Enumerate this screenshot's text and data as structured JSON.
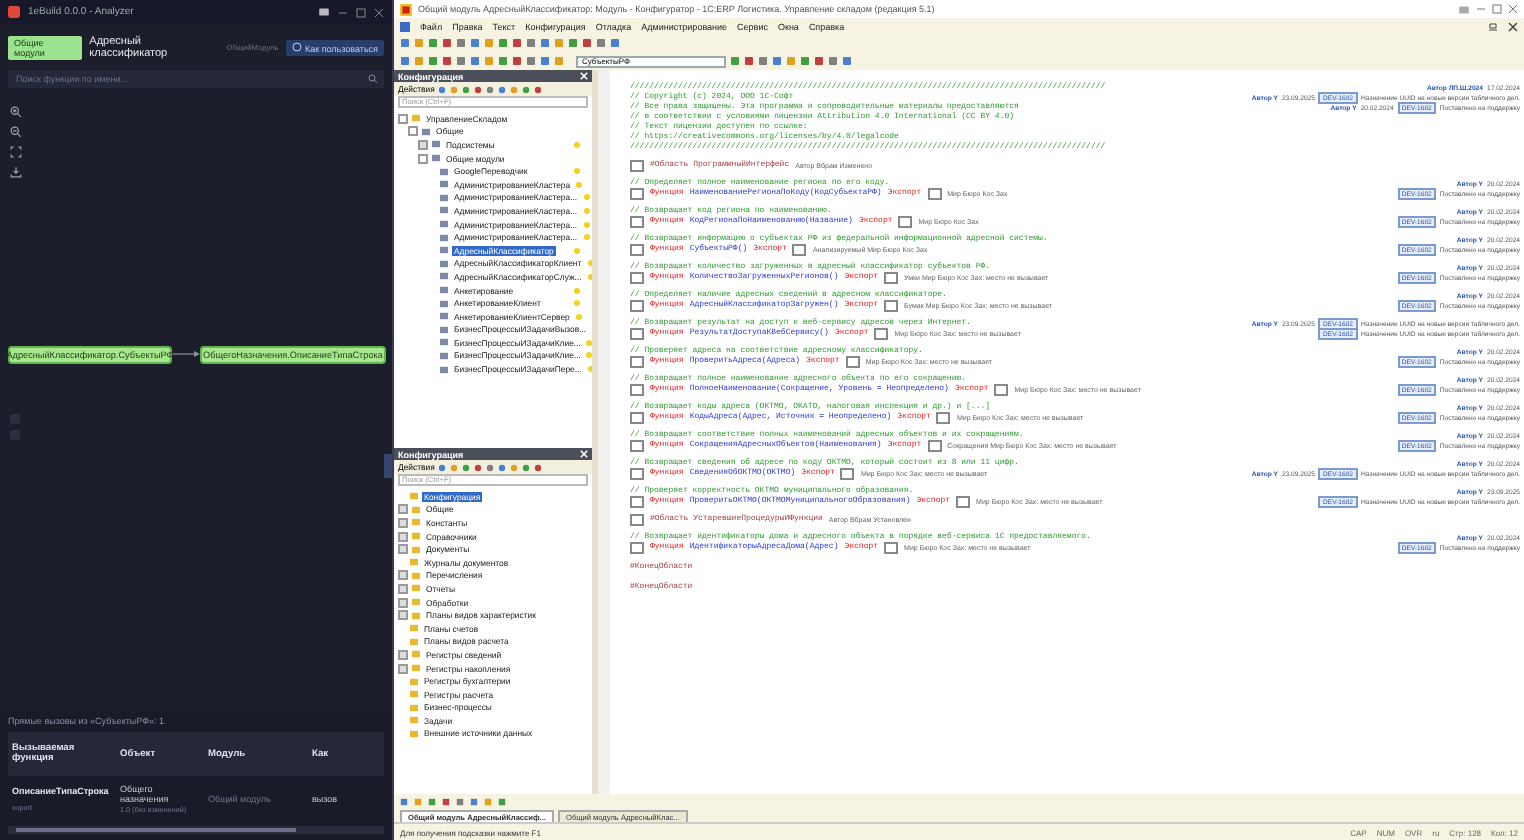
{
  "analyzer": {
    "title": "1eBuild 0.0.0 - Analyzer",
    "tag": "Общие модули",
    "object": "Адресный классификатор",
    "subtitle": "ОбщийМодуль",
    "help": "Как пользоваться",
    "search": {
      "placeholder": "Поиск функции по имени..."
    },
    "graph": {
      "nodes": [
        {
          "label": "АдресныйКлассификатор.СубъектыРФ"
        },
        {
          "label": "ОбщегоНазначения.ОписаниеТипаСтрока"
        }
      ]
    },
    "calls": {
      "title": "Прямые вызовы из «СубъектыРФ»: 1",
      "columns": [
        "Вызываемая функция",
        "Объект",
        "Модуль",
        "Как"
      ],
      "rows": [
        {
          "function": "ОписаниеТипаСтрока",
          "function_tag": "export",
          "object": "Общего назначения",
          "object_note": "1.0 (без изменений)",
          "module": "Общий модуль",
          "how": "вызов"
        }
      ]
    }
  },
  "configurator": {
    "title": "Общий модуль АдресныйКлассификатор: Модуль - Конфигуратор - 1С:ERP Логистика. Управление складом (редакция 5.1)",
    "menu": [
      "Файл",
      "Правка",
      "Текст",
      "Конфигурация",
      "Отладка",
      "Администрирование",
      "Сервис",
      "Окна",
      "Справка"
    ],
    "procedure_box": "СубъектыРФ",
    "panels": [
      {
        "title": "Конфигурация",
        "actions": "Действия",
        "search": {
          "placeholder": "Поиск (Ctrl+F)"
        },
        "tree": [
          {
            "label": "УправлениеСкладом",
            "expanded": true,
            "selected": false,
            "children": [
              {
                "label": "Общие",
                "expanded": true,
                "selected": false,
                "children": [
                  {
                    "label": "Подсистемы",
                    "expanded": false,
                    "selected": false
                  },
                  {
                    "label": "Общие модули",
                    "expanded": true,
                    "selected": false,
                    "children": [
                      {
                        "label": "GoogleПереводчик",
                        "selected": false
                      },
                      {
                        "label": "АдминистрированиеКластера",
                        "selected": false
                      },
                      {
                        "label": "АдминистрированиеКластера...",
                        "selected": false
                      },
                      {
                        "label": "АдминистрированиеКластера...",
                        "selected": false
                      },
                      {
                        "label": "АдминистрированиеКластера...",
                        "selected": false
                      },
                      {
                        "label": "АдминистрированиеКластера...",
                        "selected": false
                      },
                      {
                        "label": "АдресныйКлассификатор",
                        "selected": true
                      },
                      {
                        "label": "АдресныйКлассификаторКлиент",
                        "selected": false
                      },
                      {
                        "label": "АдресныйКлассификаторСлуж...",
                        "selected": false
                      },
                      {
                        "label": "Анкетирование",
                        "selected": false
                      },
                      {
                        "label": "АнкетированиеКлиент",
                        "selected": false
                      },
                      {
                        "label": "АнкетированиеКлиентСервер",
                        "selected": false
                      },
                      {
                        "label": "БизнесПроцессыИЗадачиВызов...",
                        "selected": false
                      },
                      {
                        "label": "БизнесПроцессыИЗадачиКлие...",
                        "selected": false
                      },
                      {
                        "label": "БизнесПроцессыИЗадачиКлие...",
                        "selected": false
                      },
                      {
                        "label": "БизнесПроцессыИЗадачиПере...",
                        "selected": false
                      }
                    ]
                  }
                ]
              }
            ]
          }
        ]
      },
      {
        "title": "Конфигурация",
        "actions": "Действия",
        "search": {
          "placeholder": "Поиск (Ctrl+F)"
        },
        "tree": [
          {
            "label": "Конфигурация",
            "selected": true
          },
          {
            "label": "Общие",
            "expanded": false,
            "selected": false
          },
          {
            "label": "Константы",
            "expanded": false,
            "selected": false
          },
          {
            "label": "Справочники",
            "expanded": false,
            "selected": false
          },
          {
            "label": "Документы",
            "expanded": false,
            "selected": false
          },
          {
            "label": "Журналы документов",
            "selected": false
          },
          {
            "label": "Перечисления",
            "expanded": false,
            "selected": false
          },
          {
            "label": "Отчеты",
            "expanded": false,
            "selected": false
          },
          {
            "label": "Обработки",
            "expanded": false,
            "selected": false
          },
          {
            "label": "Планы видов характеристик",
            "expanded": false,
            "selected": false
          },
          {
            "label": "Планы счетов",
            "selected": false
          },
          {
            "label": "Планы видов расчета",
            "selected": false
          },
          {
            "label": "Регистры сведений",
            "expanded": false,
            "selected": false
          },
          {
            "label": "Регистры накопления",
            "expanded": false,
            "selected": false
          },
          {
            "label": "Регистры бухгалтерии",
            "selected": false
          },
          {
            "label": "Регистры расчета",
            "selected": false
          },
          {
            "label": "Бизнес-процессы",
            "selected": false
          },
          {
            "label": "Задачи",
            "selected": false
          },
          {
            "label": "Внешние источники данных",
            "selected": false
          }
        ]
      }
    ],
    "code": [
      {
        "kind": "header",
        "text": "///////////////////////////////////////////////////////////////////////////////////////////////////",
        "note": {
          "author": "Автор ЛП.Ш.2024",
          "date": "17.02.2024"
        }
      },
      {
        "kind": "header",
        "text": "// Copyright (c) 2024, ООО 1С-Софт",
        "note": {
          "author": "Автор Y",
          "date": "23.09.2025",
          "ticket": "DEV-1682",
          "text": "Назначение UUID на новые версии табличного дел."
        }
      },
      {
        "kind": "header",
        "text": "// Все права защищены. Эта программа и сопроводительные материалы предоставляются",
        "note": {
          "author": "Автор Y",
          "date": "20.02.2024",
          "ticket": "DEV-1682",
          "text": "Поставлено на поддержку"
        }
      },
      {
        "kind": "header",
        "text": "// в соответствии с условиями лицензии Attribution 4.0 International (CC BY 4.0)"
      },
      {
        "kind": "header",
        "text": "// Текст лицензии доступен по ссылке:"
      },
      {
        "kind": "header",
        "text": "// https://creativecommons.org/licenses/by/4.0/legalcode"
      },
      {
        "kind": "header",
        "text": "///////////////////////////////////////////////////////////////////////////////////////////////////"
      },
      {
        "kind": "region",
        "text": "#Область ПрограммныйИнтерфейс",
        "tail": "Автор Вбрам Изменено"
      },
      {
        "kind": "comment",
        "text": "// Определяет полное наименование региона по его коду.",
        "note": {
          "author": "Автор Y",
          "date": "20.02.2024"
        }
      },
      {
        "kind": "func",
        "keyword": "Функция",
        "name": "НаименованиеРегионаПоКоду(КодСубъектаРФ)",
        "export": "Экспорт",
        "tail": "Мир Бюро Кос Зах",
        "note": {
          "ticket": "DEV-1682",
          "text": "Поставлено на поддержку"
        }
      },
      {
        "kind": "comment",
        "text": "// Возвращает код региона по наименованию.",
        "note": {
          "author": "Автор Y",
          "date": "20.02.2024"
        }
      },
      {
        "kind": "func",
        "keyword": "Функция",
        "name": "КодРегионаПоНаименованию(Название)",
        "export": "Экспорт",
        "tail": "Мир Бюро Кос Зах",
        "note": {
          "ticket": "DEV-1682",
          "text": "Поставлено на поддержку"
        }
      },
      {
        "kind": "comment",
        "text": "// Возвращает информацию о субъектах РФ из федеральной информационной адресной системы.",
        "note": {
          "author": "Автор Y",
          "date": "20.02.2024"
        }
      },
      {
        "kind": "func",
        "keyword": "Функция",
        "name": "СубъектыРФ()",
        "export": "Экспорт",
        "tail": "Анализируемый Мир Бюро Кос Зах",
        "note": {
          "ticket": "DEV-1682",
          "text": "Поставлено на поддержку"
        }
      },
      {
        "kind": "comment",
        "text": "// Возвращает количество загруженных в адресный классификатор субъектов РФ.",
        "note": {
          "author": "Автор Y",
          "date": "20.02.2024"
        }
      },
      {
        "kind": "func",
        "keyword": "Функция",
        "name": "КоличествоЗагруженныхРегионов()",
        "export": "Экспорт",
        "tail": "Умки Мир Бюро Кос Зах: место не вызывает",
        "note": {
          "ticket": "DEV-1682",
          "text": "Поставлено на поддержку"
        }
      },
      {
        "kind": "comment",
        "text": "// Определяет наличие адресных сведений в адресном классификаторе.",
        "note": {
          "author": "Автор Y",
          "date": "20.02.2024"
        }
      },
      {
        "kind": "func",
        "keyword": "Функция",
        "name": "АдресныйКлассификаторЗагружен()",
        "export": "Экспорт",
        "tail": "Бумак Мир Бюро Кос Зах: место не вызывает",
        "note": {
          "ticket": "DEV-1682",
          "text": "Поставлено на поддержку"
        }
      },
      {
        "kind": "comment",
        "text": "// Возвращает результат на доступ к веб-сервису адресов через Интернет.",
        "note": {
          "author": "Автор Y",
          "date": "23.09.2025",
          "ticket": "DEV-1682",
          "text": "Назначение UUID на новые версии табличного дел."
        }
      },
      {
        "kind": "func",
        "keyword": "Функция",
        "name": "РезультатДоступаКВебСервису()",
        "export": "Экспорт",
        "tail": "Мир Бюро Кос Зах: место не вызывает",
        "note": {
          "ticket": "DEV-1682",
          "text": "Назначение UUID на новые версии табличного дел."
        }
      },
      {
        "kind": "comment",
        "text": "// Проверяет адреса на соответствие адресному классификатору.",
        "note": {
          "author": "Автор Y",
          "date": "20.02.2024"
        }
      },
      {
        "kind": "func",
        "keyword": "Функция",
        "name": "ПроверитьАдреса(Адреса)",
        "export": "Экспорт",
        "tail": "Мир Бюро Кос Зах: место не вызывает",
        "note": {
          "ticket": "DEV-1682",
          "text": "Поставлено на поддержку"
        }
      },
      {
        "kind": "comment",
        "text": "// Возвращает полное наименование адресного объекта по его сокращению.",
        "note": {
          "author": "Автор Y",
          "date": "20.02.2024"
        }
      },
      {
        "kind": "func",
        "keyword": "Функция",
        "name": "ПолноеНаименование(Сокращение, Уровень = Неопределено)",
        "export": "Экспорт",
        "tail": "Мир Бюро Кос Зах: место не вызывает",
        "note": {
          "ticket": "DEV-1682",
          "text": "Поставлено на поддержку"
        }
      },
      {
        "kind": "comment",
        "text": "// Возвращает коды адреса (ОКТМО, ОКАТО, налоговая инспекция и др.) и [...]",
        "note": {
          "author": "Автор Y",
          "date": "20.02.2024"
        }
      },
      {
        "kind": "func",
        "keyword": "Функция",
        "name": "КодыАдреса(Адрес, Источник = Неопределено)",
        "export": "Экспорт",
        "tail": "Мир Бюро Кос Зах: место не вызывает",
        "note": {
          "ticket": "DEV-1682",
          "text": "Поставлено на поддержку"
        }
      },
      {
        "kind": "comment",
        "text": "// Возвращает соответствие полных наименований адресных объектов и их сокращениям.",
        "note": {
          "author": "Автор Y",
          "date": "20.02.2024"
        }
      },
      {
        "kind": "func",
        "keyword": "Функция",
        "name": "СокращенияАдресныхОбъектов(Наименования)",
        "export": "Экспорт",
        "tail": "Сокращения Мир Бюро Кос Зах: место не вызывает",
        "note": {
          "ticket": "DEV-1682",
          "text": "Поставлено на поддержку"
        }
      },
      {
        "kind": "comment",
        "text": "// Возвращает сведения об адресе по коду ОКТМО, который состоит из 8 или 11 цифр.",
        "note": {
          "author": "Автор Y",
          "date": "20.02.2024"
        }
      },
      {
        "kind": "func",
        "keyword": "Функция",
        "name": "СведенияОбОКТМО(ОКТМО)",
        "export": "Экспорт",
        "tail": "Мир Бюро Кос Зах: место не вызывает",
        "note": {
          "author": "Автор Y",
          "date": "23.09.2025",
          "ticket": "DEV-1682",
          "text": "Назначение UUID на новые версии табличного дел."
        }
      },
      {
        "kind": "comment",
        "text": "// Проверяет корректность ОКТМО муниципального образования.",
        "note": {
          "author": "Автор Y",
          "date": "23.09.2025"
        }
      },
      {
        "kind": "func",
        "keyword": "Функция",
        "name": "ПроверитьОКТМО(ОКТМОМуниципальногоОбразования)",
        "export": "Экспорт",
        "tail": "Мир Бюро Кос Зах: место не вызывает",
        "note": {
          "ticket": "DEV-1682",
          "text": "Назначение UUID на новые версии табличного дел."
        }
      },
      {
        "kind": "region",
        "text": "#Область УстаревшиеПроцедурыИФункции",
        "tail": "Автор Вбрам Установлен"
      },
      {
        "kind": "comment",
        "text": "// Возвращает идентификаторы дома и адресного объекта в порядке веб-сервиса 1С предоставляемого.",
        "note": {
          "author": "Автор Y",
          "date": "20.02.2024"
        }
      },
      {
        "kind": "func",
        "keyword": "Функция",
        "name": "ИдентификаторыАдресаДома(Адрес)",
        "export": "Экспорт",
        "tail": "Мир Бюро Кос Зах: место не вызывает",
        "note": {
          "ticket": "DEV-1682",
          "text": "Поставлено на поддержку"
        }
      },
      {
        "kind": "end",
        "text": "#КонецОбласти"
      },
      {
        "kind": "end",
        "text": "#КонецОбласти"
      }
    ],
    "tabs": [
      {
        "label": "Общий модуль АдресныйКлассиф...",
        "selected": true
      },
      {
        "label": "Общий модуль АдресныйКлас...",
        "selected": false
      }
    ],
    "status": "Для получения подсказки нажмите F1",
    "indicators": [
      "CAP",
      "NUM",
      "OVR",
      "ru",
      "Стр: 128",
      "Кол: 12"
    ]
  }
}
